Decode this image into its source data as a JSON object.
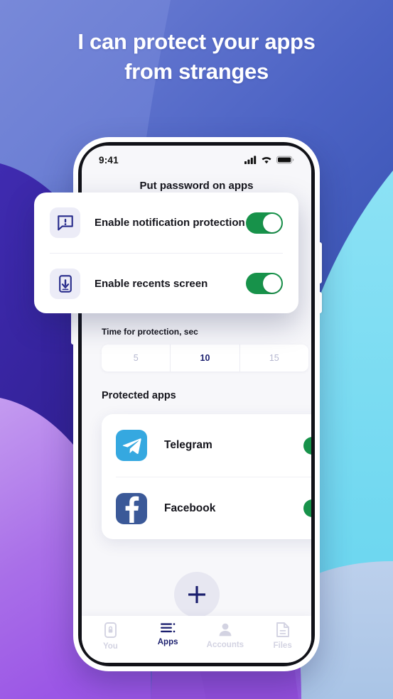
{
  "headline": {
    "line1": "I can protect your apps",
    "line2": "from stranges"
  },
  "colors": {
    "bg_blue_top": "#6b7ad0",
    "bg_blue_deep": "#2b47a8",
    "bg_indigo": "#2e1f8f",
    "bg_purple": "#a163e8",
    "bg_cyan": "#6fd8f0",
    "bg_periwinkle": "#b6cbe9",
    "accent_navy": "#1b1f6e",
    "toggle_green": "#17924a",
    "telegram_blue": "#35a8e0",
    "facebook_blue": "#3b5998"
  },
  "phone": {
    "status_bar": {
      "time": "9:41",
      "icons": [
        "cellular-signal-icon",
        "wifi-icon",
        "battery-icon"
      ]
    },
    "screen_title": "Put password on apps",
    "time_protection": {
      "label": "Time for protection, sec",
      "options": [
        "5",
        "10",
        "15"
      ],
      "selected": "10"
    },
    "protected_apps": {
      "title": "Protected apps",
      "items": [
        {
          "name": "Telegram",
          "icon": "telegram-icon",
          "enabled": true
        },
        {
          "name": "Facebook",
          "icon": "facebook-icon",
          "enabled": true
        }
      ]
    },
    "fab": {
      "icon": "plus-icon",
      "label": "+"
    },
    "bottom_nav": [
      {
        "label": "You",
        "icon": "phone-lock-icon",
        "active": false
      },
      {
        "label": "Apps",
        "icon": "list-icon",
        "active": true
      },
      {
        "label": "Accounts",
        "icon": "person-icon",
        "active": false
      },
      {
        "label": "Files",
        "icon": "document-icon",
        "active": false
      }
    ]
  },
  "overlay_card": {
    "rows": [
      {
        "label": "Enable notification protection",
        "icon": "notification-alert-icon",
        "enabled": true
      },
      {
        "label": "Enable recents screen",
        "icon": "phone-download-icon",
        "enabled": true
      }
    ]
  }
}
